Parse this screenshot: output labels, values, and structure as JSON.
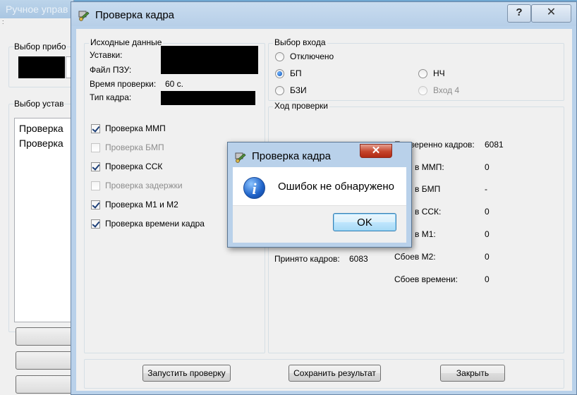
{
  "background_window": {
    "title": "Ручное управ",
    "menu_fragment": ":",
    "device_group_label": "Выбор прибо",
    "settings_group_label": "Выбор устав",
    "list_items": [
      "Проверка",
      "Проверка"
    ]
  },
  "main_window": {
    "title": "Проверка кадра",
    "help_label": "?",
    "close_label": "✕",
    "source_group": {
      "label": "Исходные данные",
      "settings_label": "Уставки:",
      "firmware_label": "Файл ПЗУ:",
      "check_time_label": "Время проверки:",
      "check_time_value": "60 с.",
      "frame_type_label": "Тип кадра:"
    },
    "checks": [
      {
        "label": "Проверка ММП",
        "checked": true,
        "enabled": true
      },
      {
        "label": "Проверка БМП",
        "checked": false,
        "enabled": false
      },
      {
        "label": "Проверка ССК",
        "checked": true,
        "enabled": true
      },
      {
        "label": "Проверка задержки",
        "checked": false,
        "enabled": false
      },
      {
        "label": "Проверка М1 и М2",
        "checked": true,
        "enabled": true
      },
      {
        "label": "Проверка времени кадра",
        "checked": true,
        "enabled": true
      }
    ],
    "input_group": {
      "label": "Выбор входа",
      "options": [
        {
          "label": "Отключено",
          "selected": false,
          "enabled": true
        },
        {
          "label": "БП",
          "selected": true,
          "enabled": true
        },
        {
          "label": "НЧ",
          "selected": false,
          "enabled": true
        },
        {
          "label": "БЗИ",
          "selected": false,
          "enabled": true
        },
        {
          "label": "Вход 4",
          "selected": false,
          "enabled": false
        }
      ]
    },
    "progress_group": {
      "label": "Ход проверки",
      "received_label": "Принято кадров:",
      "received_value": "6083",
      "checked_frames_label": "Проверенно кадров:",
      "checked_frames_value": "6081",
      "mmp_label": "в ММП:",
      "mmp_value": "0",
      "bmp_label": "в БМП",
      "bmp_value": "-",
      "ssk_label": "в ССК:",
      "ssk_value": "0",
      "m1_label": "в М1:",
      "m1_value": "0",
      "m2_label": "Сбоев М2:",
      "m2_value": "0",
      "time_label": "Сбоев времени:",
      "time_value": "0"
    },
    "buttons": {
      "start": "Запустить проверку",
      "save": "Сохранить результат",
      "close": "Закрыть"
    }
  },
  "message_box": {
    "title": "Проверка кадра",
    "close_label": "✕",
    "icon": "info-icon",
    "icon_glyph": "i",
    "message": "Ошибок не обнаружено",
    "ok_label": "OK"
  }
}
